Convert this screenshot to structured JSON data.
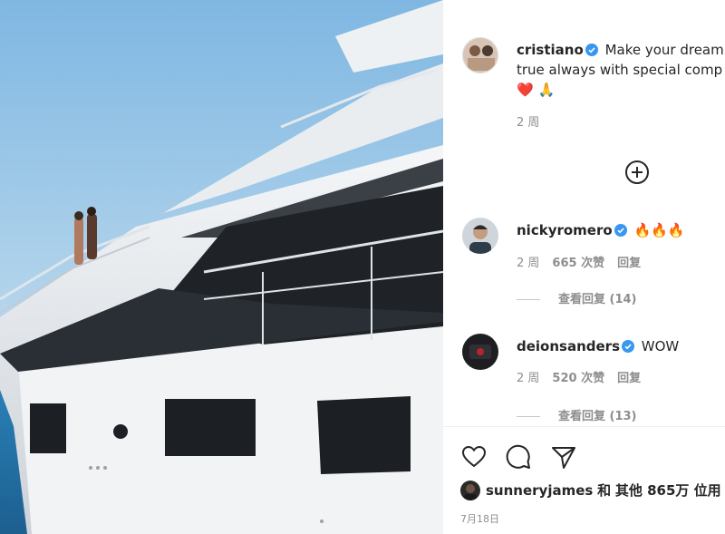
{
  "post": {
    "author": "cristiano",
    "caption": "Make your dream",
    "caption_line2": "true always with special comp",
    "caption_emoji": "❤️ 🙏",
    "time": "2 周"
  },
  "comments": [
    {
      "username": "nickyromero",
      "text": "🔥🔥🔥",
      "time": "2 周",
      "likes": "665 次赞",
      "reply_label": "回复",
      "view_replies": "查看回复 (14)"
    },
    {
      "username": "deionsanders",
      "text": "WOW",
      "time": "2 周",
      "likes": "520 次赞",
      "reply_label": "回复",
      "view_replies": "查看回复 (13)"
    }
  ],
  "likes": {
    "username": "sunneryjames",
    "connector": "和",
    "others": "其他 865万 位用"
  },
  "date": "7月18日",
  "colors": {
    "verified": "#3897f0",
    "text": "#262626",
    "muted": "#8e8e8e",
    "sky_top": "#9cc8e8",
    "sea": "#2f7fb8"
  },
  "icons": [
    "plus-circle-icon",
    "heart-icon",
    "comment-icon",
    "share-icon",
    "verified-badge-icon"
  ]
}
